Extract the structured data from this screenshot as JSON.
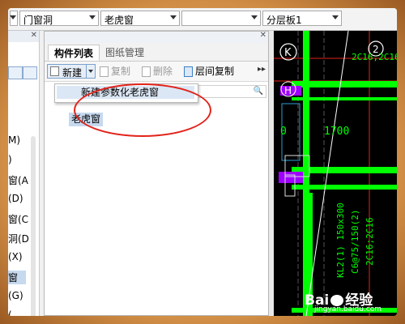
{
  "combos": [
    {
      "value": "门窗洞"
    },
    {
      "value": "老虎窗"
    },
    {
      "value": ""
    },
    {
      "value": "分层板1"
    }
  ],
  "left_panel": {
    "items": [
      {
        "label": "M)",
        "selected": false
      },
      {
        "label": ")",
        "selected": false
      },
      {
        "label": "窗(A",
        "selected": false
      },
      {
        "label": "(D)",
        "selected": false
      },
      {
        "label": "窗(C",
        "selected": false
      },
      {
        "label": "洞(D",
        "selected": false
      },
      {
        "label": "(X)",
        "selected": false
      },
      {
        "label": "窗",
        "selected": true
      },
      {
        "label": "(G)",
        "selected": false
      },
      {
        "label": "(",
        "selected": false
      }
    ]
  },
  "component_panel": {
    "tabs": [
      {
        "label": "构件列表",
        "active": true
      },
      {
        "label": "图纸管理",
        "active": false
      }
    ],
    "toolbar": {
      "new_label": "新建",
      "copy_label": "复制",
      "delete_label": "删除",
      "layer_copy_label": "层间复制"
    },
    "dropdown_menu": {
      "items": [
        "新建参数化老虎窗"
      ]
    },
    "tree_items": [
      "老虎窗"
    ]
  },
  "cad": {
    "labels": [
      "K",
      "2",
      "H",
      "2C16;2C16",
      "1700",
      "0",
      "KL2(1) 150x300",
      "C6@75/150(2)",
      "2C16;2C16"
    ]
  },
  "watermark": {
    "brand": "Bai",
    "brand_cn": "经验",
    "url": "jingyan.baidu.com"
  },
  "colors": {
    "highlight": "#c6d9ef",
    "cad_green": "#00ff00",
    "cad_purple": "#a000ff",
    "annotation_red": "#e2231a"
  }
}
